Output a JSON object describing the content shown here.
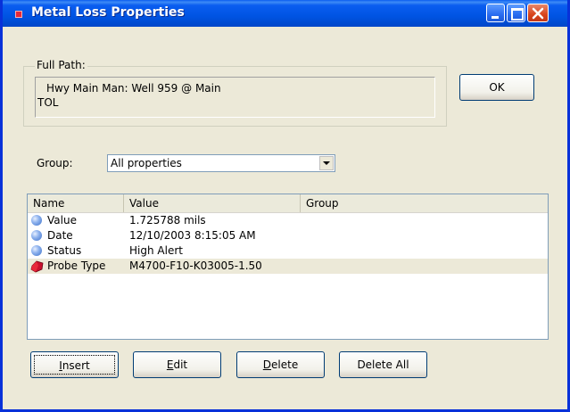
{
  "window": {
    "title": "Metal Loss Properties"
  },
  "full_path": {
    "label": "Full Path:",
    "line1": "Hwy Main Man: Well 959 @ Main",
    "line2": "TOL"
  },
  "ok_button": "OK",
  "group": {
    "label": "Group:",
    "selected": "All properties"
  },
  "list": {
    "columns": [
      "Name",
      "Value",
      "Group"
    ],
    "rows": [
      {
        "name": "Value",
        "value": "1.725788 mils",
        "group": "",
        "icon": "sphere-icon"
      },
      {
        "name": "Date",
        "value": "12/10/2003 8:15:05 AM",
        "group": "",
        "icon": "sphere-icon"
      },
      {
        "name": "Status",
        "value": "High Alert",
        "group": "",
        "icon": "sphere-icon"
      },
      {
        "name": "Probe Type",
        "value": "M4700-F10-K03005-1.50",
        "group": "",
        "icon": "probe-icon"
      }
    ]
  },
  "buttons": {
    "insert_mn": "I",
    "insert_rest": "nsert",
    "edit_mn": "E",
    "edit_rest": "dit",
    "delete_mn": "D",
    "delete_rest": "elete",
    "delete_all": "Delete All"
  },
  "colors": {
    "titlebar": "#0054e3",
    "face": "#ece9d8",
    "close": "#d8441c"
  }
}
